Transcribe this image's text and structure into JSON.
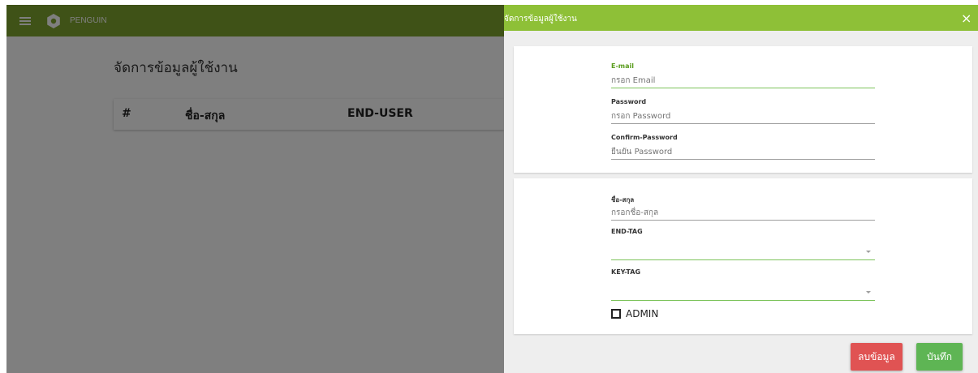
{
  "app": {
    "brand": "PENGUIN"
  },
  "page": {
    "heading": "จัดการข้อมูลผู้ใช้งาน",
    "table": {
      "columns": [
        "#",
        "ชื่อ-สกุล",
        "END-USER"
      ]
    }
  },
  "panel": {
    "title": "จัดการข้อมูลผู้ใช้งาน",
    "close": "×",
    "account": {
      "email": {
        "label": "E-mail",
        "placeholder": "กรอก Email"
      },
      "password": {
        "label": "Password",
        "placeholder": "กรอก Password"
      },
      "confirm": {
        "label": "Confirm-Password",
        "placeholder": "ยืนยัน Password"
      }
    },
    "profile": {
      "name": {
        "label": "ชื่อ-สกุล",
        "placeholder": "กรอกชื่อ-สกุล"
      },
      "end_tag": {
        "label": "END-TAG",
        "value": ""
      },
      "key_tag": {
        "label": "KEY-TAG",
        "value": ""
      },
      "admin": {
        "label": "ADMIN",
        "checked": false
      }
    },
    "buttons": {
      "delete": "ลบข้อมูล",
      "save": "บันทึก"
    }
  },
  "colors": {
    "topbar": "#7fa52e",
    "panel_header": "#8ec037",
    "accent_green": "#7cc35a",
    "delete_button": "#e05353",
    "save_button": "#5eb554"
  },
  "icons": {
    "menu": "hamburger-icon",
    "logo": "penguin-logo-icon",
    "close": "close-icon",
    "dropdown": "caret-down-icon"
  }
}
